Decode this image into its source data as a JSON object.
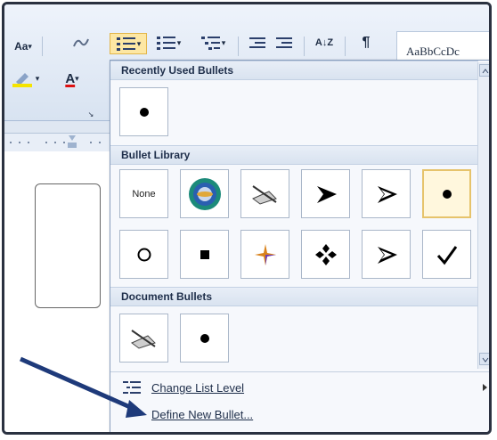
{
  "ribbon": {
    "font_size_label": "Aa",
    "paragraph_mark": "¶",
    "sort_label": "A↓Z",
    "styles_preview": "AaBbCcDc"
  },
  "menu": {
    "recent": {
      "title": "Recently Used Bullets",
      "items": [
        "bullet-dot"
      ]
    },
    "library": {
      "title": "Bullet Library",
      "none_label": "None",
      "items": [
        "none",
        "circle-emblem",
        "pen-arrow",
        "arrowhead",
        "arrowhead-outline",
        "bullet-dot",
        "bullet-circle",
        "bullet-square",
        "color-star",
        "four-diamonds",
        "arrowhead-outline",
        "check-mark"
      ],
      "selected_index": 5
    },
    "document": {
      "title": "Document Bullets",
      "items": [
        "pen-arrow",
        "bullet-dot"
      ]
    },
    "change_level": "Change List Level",
    "define_new": "Define New Bullet..."
  },
  "colors": {
    "accent": "#e6c36b",
    "pointer": "#1e3a7a"
  }
}
